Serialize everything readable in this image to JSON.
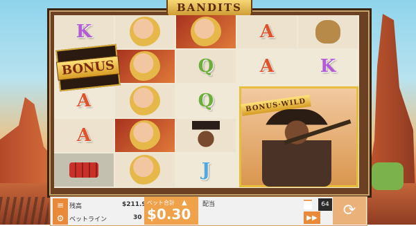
{
  "game": {
    "title": "BANDITS"
  },
  "reels": [
    [
      "K",
      "bonus",
      "A",
      "A",
      "dynamite"
    ],
    [
      "girl",
      "girl",
      "girl",
      "girl",
      "girl"
    ],
    [
      "girl",
      "Q",
      "Q",
      "bandit",
      "J"
    ],
    [
      "A",
      "A",
      "wild",
      "wild",
      "wild"
    ],
    [
      "bag",
      "K",
      "wild",
      "wild",
      "wild"
    ]
  ],
  "symbols": {
    "bonus_label": "BONUS",
    "wild_label": "BONUS·WILD"
  },
  "hud": {
    "menu_icon": "hamburger-icon",
    "settings_icon": "gear-icon",
    "balance_label": "残高",
    "balance_value": "$211.98",
    "paylines_label": "ベットライン",
    "paylines_value": "30",
    "bet_total_label": "ベット合計",
    "bet_total_value": "$0.30",
    "payout_label": "配当",
    "autoplay_count": "64",
    "fast_icon": "fast-forward-icon",
    "spin_icon": "spin-icon"
  }
}
